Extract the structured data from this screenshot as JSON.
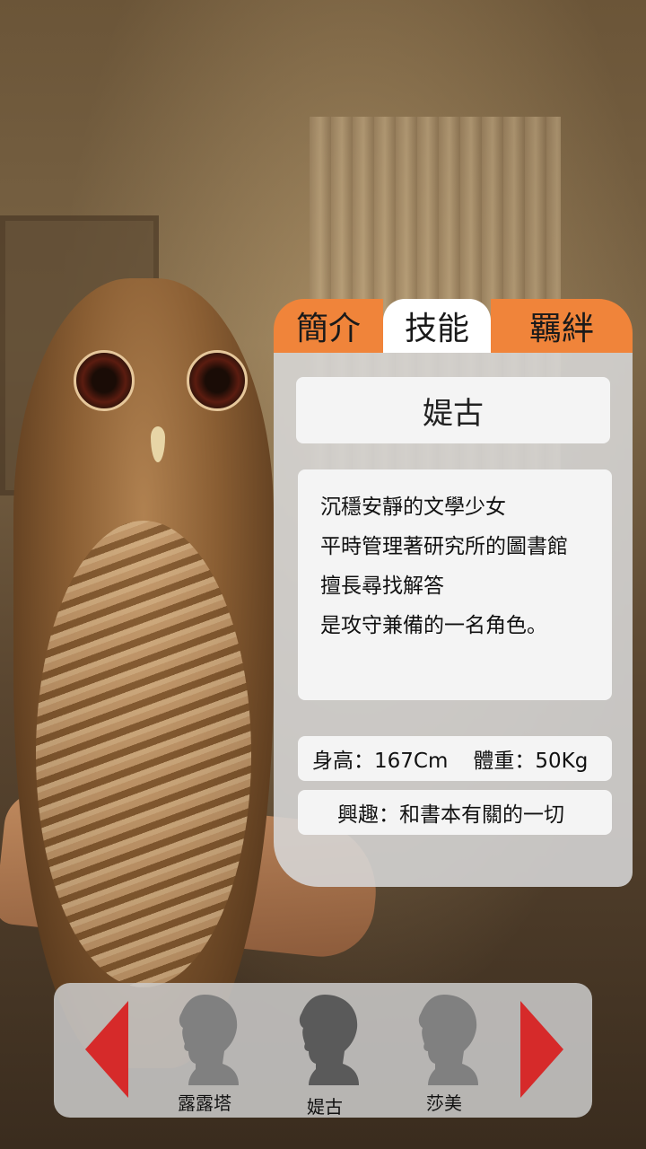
{
  "tabs": [
    {
      "label": "簡介"
    },
    {
      "label": "技能"
    },
    {
      "label": "羈絆"
    }
  ],
  "character": {
    "name": "媞古",
    "description": [
      "沉穩安靜的文學少女",
      "平時管理著研究所的圖書館",
      "擅長尋找解答",
      "是攻守兼備的一名角色。"
    ],
    "height": "身高：167Cm",
    "weight": "體重：50Kg",
    "hobby": "興趣：和書本有關的一切"
  },
  "selector": {
    "characters": [
      {
        "label": "露露塔",
        "icon": "profile-silhouette-icon"
      },
      {
        "label": "媞古",
        "icon": "profile-silhouette-icon"
      },
      {
        "label": "莎美",
        "icon": "profile-silhouette-icon"
      }
    ],
    "prev_icon": "left-arrow-icon",
    "next_icon": "right-arrow-icon"
  },
  "colors": {
    "tab_orange": "#f0843a",
    "arrow_red": "#d62a2a",
    "silhouette_selected": "#5a5a5a",
    "silhouette": "#808080"
  }
}
